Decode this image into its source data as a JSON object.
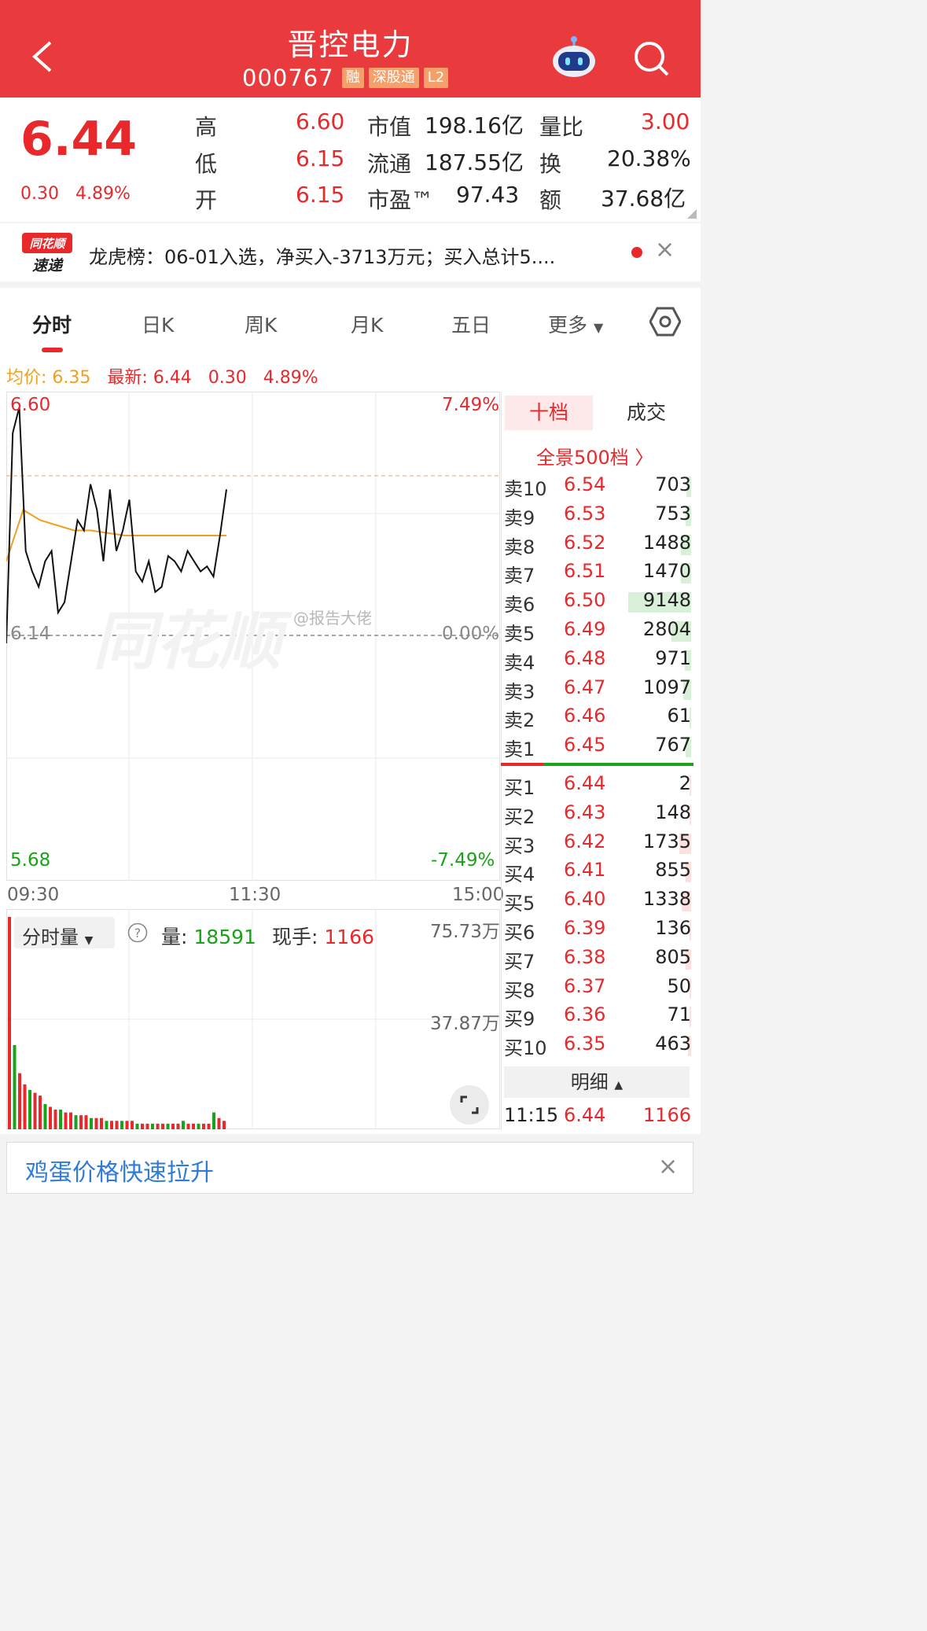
{
  "header": {
    "title": "晋控电力",
    "code": "000767",
    "tags": [
      "融",
      "深股通",
      "L2"
    ]
  },
  "quote": {
    "price": "6.44",
    "change": "0.30",
    "change_pct": "4.89%",
    "high_label": "高",
    "high": "6.60",
    "low_label": "低",
    "low": "6.15",
    "open_label": "开",
    "open": "6.15",
    "mcap_label": "市值",
    "mcap": "198.16亿",
    "float_label": "流通",
    "float": "187.55亿",
    "pe_label": "市盈™",
    "pe": "97.43",
    "vr_label": "量比",
    "vr": "3.00",
    "turnover_label": "换",
    "turnover": "20.38%",
    "amount_label": "额",
    "amount": "37.68亿"
  },
  "news": {
    "logo_top": "同花顺",
    "logo_bottom": "速递",
    "text": "龙虎榜：06-01入选，净买入-3713万元；买入总计5...."
  },
  "tabs": [
    "分时",
    "日K",
    "周K",
    "月K",
    "五日",
    "更多"
  ],
  "chart": {
    "avg_label": "均价: 6.35",
    "latest_label": "最新: 6.44",
    "latest_change": "0.30",
    "latest_pct": "4.89%",
    "top_price": "6.60",
    "top_pct": "7.49%",
    "mid_price": "6.14",
    "mid_pct": "0.00%",
    "bot_price": "5.68",
    "bot_pct": "-7.49%",
    "times": [
      "09:30",
      "11:30",
      "15:00"
    ],
    "watermark": "同花顺",
    "weibo": "@报告大佬",
    "vol_selector": "分时量",
    "vol_label": "量:",
    "vol_value": "18591",
    "hand_label": "现手:",
    "hand_value": "1166",
    "vol_top": "75.73万",
    "vol_mid": "37.87万"
  },
  "chart_data": {
    "type": "line",
    "x_range": [
      "09:30",
      "15:00"
    ],
    "y_range": [
      5.68,
      6.6
    ],
    "reference": 6.14,
    "price_series": [
      6.14,
      6.55,
      6.6,
      6.32,
      6.28,
      6.25,
      6.3,
      6.32,
      6.2,
      6.22,
      6.3,
      6.38,
      6.36,
      6.45,
      6.4,
      6.3,
      6.44,
      6.32,
      6.36,
      6.42,
      6.28,
      6.26,
      6.3,
      6.24,
      6.25,
      6.31,
      6.3,
      6.28,
      6.32,
      6.3,
      6.28,
      6.29,
      6.27,
      6.35,
      6.44
    ],
    "avg_series": [
      6.3,
      6.4,
      6.38,
      6.37,
      6.36,
      6.36,
      6.355,
      6.35,
      6.35,
      6.35,
      6.35,
      6.35,
      6.35,
      6.35
    ],
    "volume_series": [
      75.7,
      30,
      20,
      16,
      14,
      13,
      12,
      9,
      8,
      7,
      7,
      6,
      6,
      5,
      5,
      5,
      4,
      4,
      4,
      3,
      3,
      3,
      3,
      3,
      3,
      2,
      2,
      2,
      2,
      2,
      2,
      2,
      2,
      2,
      3,
      2,
      2,
      2,
      2,
      2,
      6,
      4,
      3
    ]
  },
  "order_book": {
    "tab_tenlevel": "十档",
    "tab_deals": "成交",
    "full_link": "全景500档 〉",
    "asks": [
      {
        "label": "卖10",
        "price": "6.54",
        "vol": "703"
      },
      {
        "label": "卖9",
        "price": "6.53",
        "vol": "753"
      },
      {
        "label": "卖8",
        "price": "6.52",
        "vol": "1488"
      },
      {
        "label": "卖7",
        "price": "6.51",
        "vol": "1470"
      },
      {
        "label": "卖6",
        "price": "6.50",
        "vol": "9148"
      },
      {
        "label": "卖5",
        "price": "6.49",
        "vol": "2804"
      },
      {
        "label": "卖4",
        "price": "6.48",
        "vol": "971"
      },
      {
        "label": "卖3",
        "price": "6.47",
        "vol": "1097"
      },
      {
        "label": "卖2",
        "price": "6.46",
        "vol": "61"
      },
      {
        "label": "卖1",
        "price": "6.45",
        "vol": "767"
      }
    ],
    "bids": [
      {
        "label": "买1",
        "price": "6.44",
        "vol": "2"
      },
      {
        "label": "买2",
        "price": "6.43",
        "vol": "148"
      },
      {
        "label": "买3",
        "price": "6.42",
        "vol": "1735"
      },
      {
        "label": "买4",
        "price": "6.41",
        "vol": "855"
      },
      {
        "label": "买5",
        "price": "6.40",
        "vol": "1338"
      },
      {
        "label": "买6",
        "price": "6.39",
        "vol": "136"
      },
      {
        "label": "买7",
        "price": "6.38",
        "vol": "805"
      },
      {
        "label": "买8",
        "price": "6.37",
        "vol": "50"
      },
      {
        "label": "买9",
        "price": "6.36",
        "vol": "71"
      },
      {
        "label": "买10",
        "price": "6.35",
        "vol": "463"
      }
    ],
    "detail_label": "明细",
    "last_trade": {
      "time": "11:15",
      "price": "6.44",
      "vol": "1166"
    }
  },
  "banner": {
    "text": "鸡蛋价格快速拉升"
  }
}
